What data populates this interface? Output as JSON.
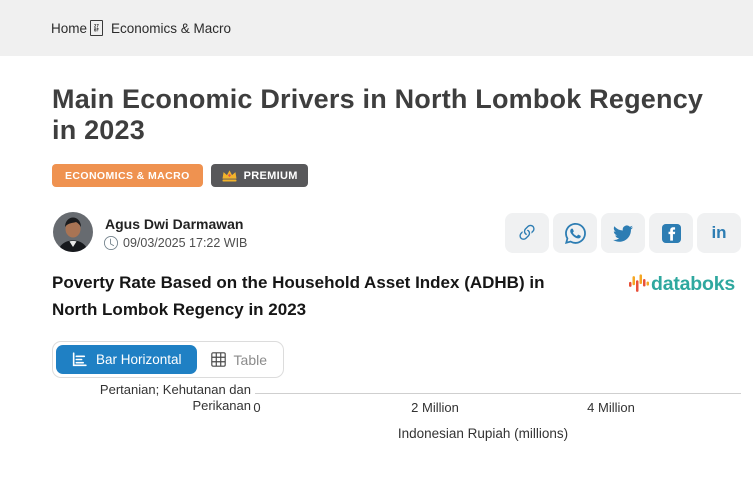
{
  "breadcrumb": {
    "home_label": "Home",
    "separator_glyph": {
      "top": "27",
      "bottom": "6F"
    },
    "section_label": "Economics & Macro"
  },
  "article": {
    "title": "Main Economic Drivers in North Lombok Regency in 2023",
    "title_lines": [
      "Main Economic Drivers in North Lombok Regency",
      "in 2023"
    ],
    "category_tag": "ECONOMICS & MACRO",
    "premium_tag": "PREMIUM",
    "author_name": "Agus Dwi Darmawan",
    "published_datetime": "09/03/2025 17:22 WIB"
  },
  "share": {
    "icon_names": [
      "copy-link-icon",
      "whatsapp-icon",
      "twitter-icon",
      "facebook-icon",
      "linkedin-icon"
    ],
    "linkedin_glyph": "in",
    "icon_color": "#2d7db3"
  },
  "widget": {
    "title": "Poverty Rate Based on the Household Asset Index (ADHB) in North Lombok Regency in 2023",
    "title_lines": [
      "Poverty Rate Based on the Household Asset Index (ADHB) in",
      "North Lombok Regency in 2023"
    ],
    "brand_text": "databoks",
    "tabs": [
      {
        "label": "Bar Horizontal",
        "active": true
      },
      {
        "label": "Table",
        "active": false
      }
    ]
  },
  "chart_data": {
    "type": "bar",
    "orientation": "horizontal",
    "title": "Poverty Rate Based on the Household Asset Index (ADHB) in North Lombok Regency in 2023",
    "categories": [
      "Pertanian; Kehutanan dan Perikanan"
    ],
    "category_label_lines": [
      "Pertanian; Kehutanan dan",
      "Perikanan"
    ],
    "xlabel": "Indonesian Rupiah (millions)",
    "x_ticks": [
      {
        "label": "0",
        "value": 0
      },
      {
        "label": "2 Million",
        "value": 2000000
      },
      {
        "label": "4 Million",
        "value": 4000000
      }
    ],
    "xlim": [
      0,
      5000000
    ],
    "grid": "off",
    "legend": "none",
    "bars_visible": false
  },
  "colors": {
    "breadcrumb_bar_bg": "#f0f0f0",
    "accent_blue": "#1f80c4",
    "tag_orange": "#ef9250",
    "premium_badge_bg": "#58585a",
    "brand_teal": "#2fa89f",
    "logo_red": "#e8503a",
    "logo_orange": "#f5a623",
    "share_icon_blue": "#2d7db3"
  }
}
